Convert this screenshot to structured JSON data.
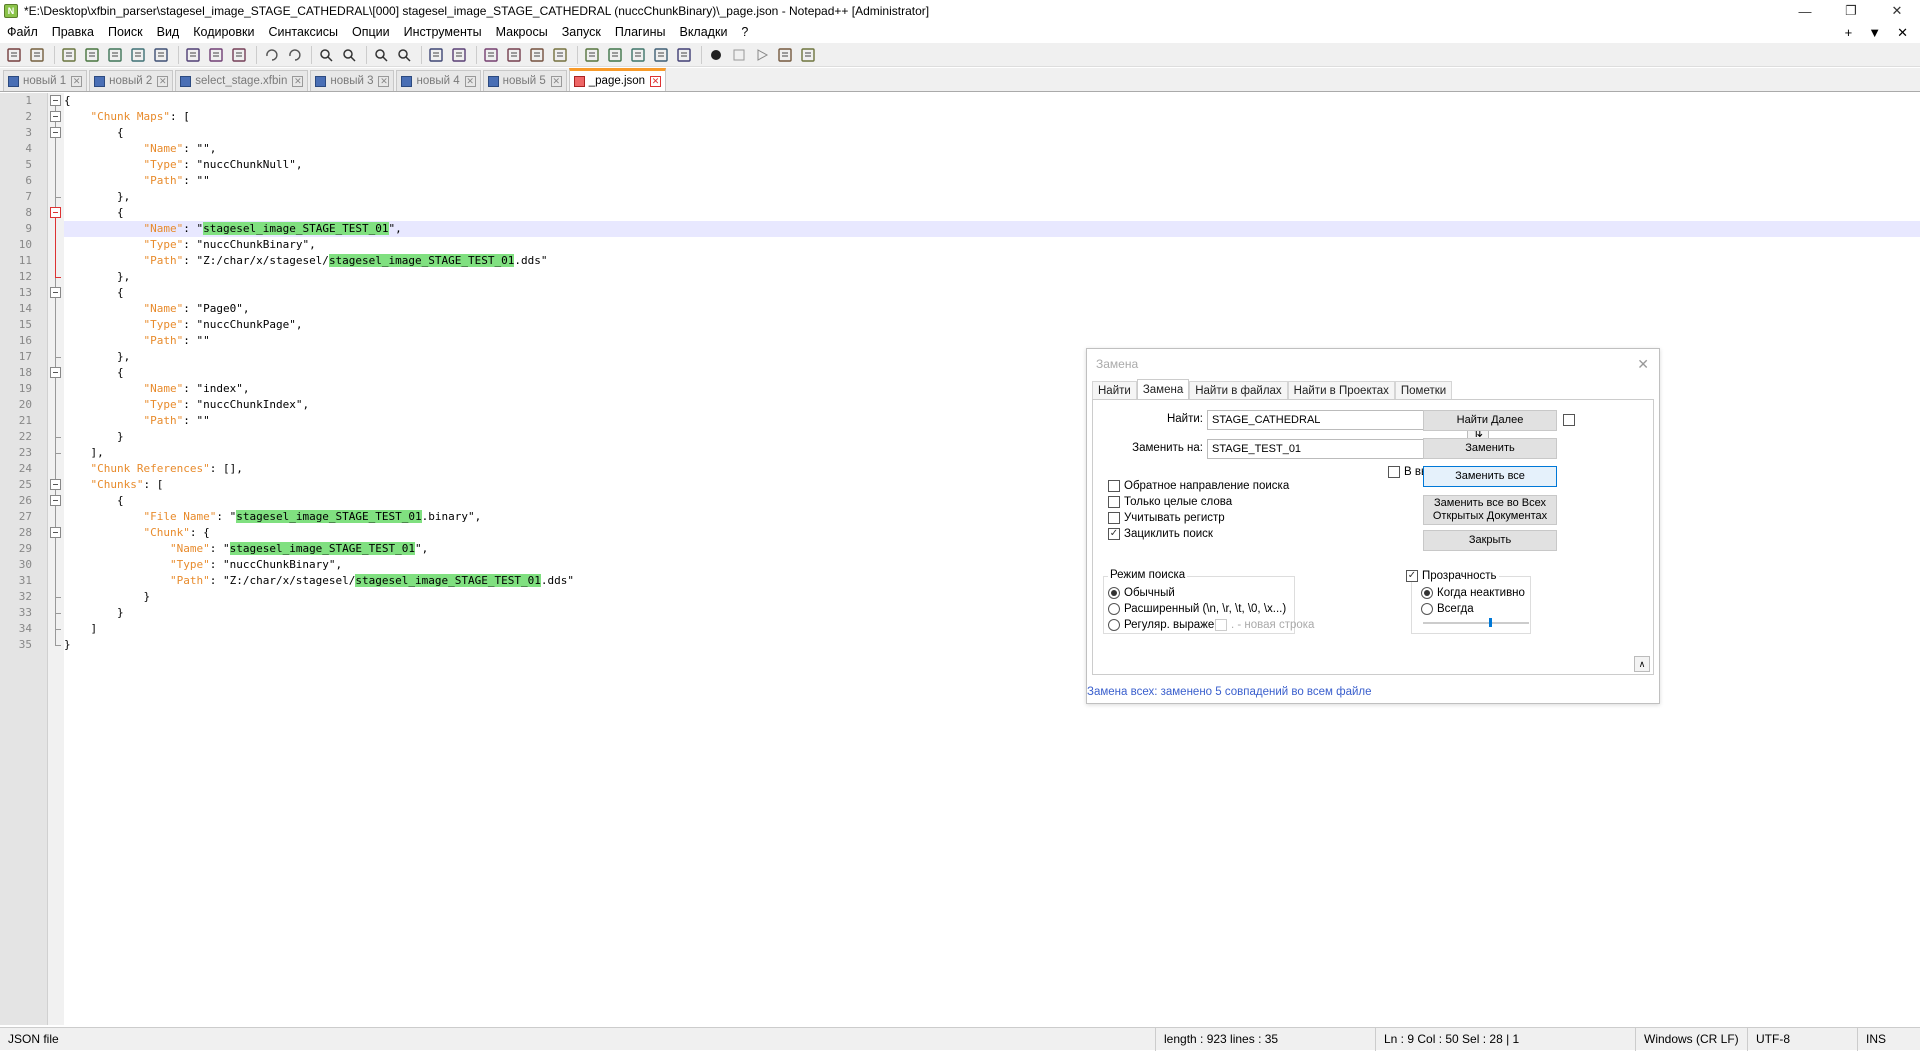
{
  "window": {
    "title": "*E:\\Desktop\\xfbin_parser\\stagesel_image_STAGE_CATHEDRAL\\[000] stagesel_image_STAGE_CATHEDRAL (nuccChunkBinary)\\_page.json - Notepad++ [Administrator]",
    "minimize": "—",
    "restore": "❐",
    "close": "✕"
  },
  "menu": {
    "items": [
      "Файл",
      "Правка",
      "Поиск",
      "Вид",
      "Кодировки",
      "Синтаксисы",
      "Опции",
      "Инструменты",
      "Макросы",
      "Запуск",
      "Плагины",
      "Вкладки",
      "?"
    ],
    "right": [
      "+",
      "▼",
      "✕"
    ]
  },
  "toolbar": {
    "icons": [
      "new-file-icon",
      "open-file-icon",
      "save-icon",
      "save-all-icon",
      "close-icon",
      "close-all-icon",
      "print-icon",
      "cut-icon",
      "copy-icon",
      "paste-icon",
      "undo-icon",
      "redo-icon",
      "find-icon",
      "replace-icon",
      "zoom-in-icon",
      "zoom-out-icon",
      "sync-vertical-icon",
      "sync-horizontal-icon",
      "word-wrap-icon",
      "show-all-chars-icon",
      "indent-guide-icon",
      "xml-tag-icon",
      "doc-map-icon",
      "doc-list-icon",
      "function-list-icon",
      "folder-workspace-icon",
      "monitor-icon",
      "record-macro-icon",
      "stop-record-icon",
      "play-macro-icon",
      "run-macro-multiple-icon",
      "save-macro-icon"
    ]
  },
  "tabs": [
    {
      "label": "новый 1",
      "active": false,
      "modified": false
    },
    {
      "label": "новый 2",
      "active": false,
      "modified": false
    },
    {
      "label": "select_stage.xfbin",
      "active": false,
      "modified": false
    },
    {
      "label": "новый 3",
      "active": false,
      "modified": false
    },
    {
      "label": "новый 4",
      "active": false,
      "modified": false
    },
    {
      "label": "новый 5",
      "active": false,
      "modified": false
    },
    {
      "label": "_page.json",
      "active": true,
      "modified": true
    }
  ],
  "editor": {
    "current_line": 9,
    "lines": [
      [
        [
          "p",
          "{"
        ]
      ],
      [
        [
          "p",
          "    "
        ],
        [
          "k",
          "\"Chunk Maps\""
        ],
        [
          "p",
          ": ["
        ]
      ],
      [
        [
          "p",
          "        {"
        ]
      ],
      [
        [
          "p",
          "            "
        ],
        [
          "k",
          "\"Name\""
        ],
        [
          "p",
          ": \"\","
        ]
      ],
      [
        [
          "p",
          "            "
        ],
        [
          "k",
          "\"Type\""
        ],
        [
          "p",
          ": \"nuccChunkNull\","
        ]
      ],
      [
        [
          "p",
          "            "
        ],
        [
          "k",
          "\"Path\""
        ],
        [
          "p",
          ": \"\""
        ]
      ],
      [
        [
          "p",
          "        },"
        ]
      ],
      [
        [
          "p",
          "        {"
        ]
      ],
      [
        [
          "p",
          "            "
        ],
        [
          "k",
          "\"Name\""
        ],
        [
          "p",
          ": \""
        ],
        [
          "hl",
          "stagesel_image_STAGE_TEST_01"
        ],
        [
          "p",
          "\","
        ]
      ],
      [
        [
          "p",
          "            "
        ],
        [
          "k",
          "\"Type\""
        ],
        [
          "p",
          ": \"nuccChunkBinary\","
        ]
      ],
      [
        [
          "p",
          "            "
        ],
        [
          "k",
          "\"Path\""
        ],
        [
          "p",
          ": \"Z:/char/x/stagesel/"
        ],
        [
          "hl",
          "stagesel_image_STAGE_TEST_01"
        ],
        [
          "p",
          ".dds\""
        ]
      ],
      [
        [
          "p",
          "        },"
        ]
      ],
      [
        [
          "p",
          "        {"
        ]
      ],
      [
        [
          "p",
          "            "
        ],
        [
          "k",
          "\"Name\""
        ],
        [
          "p",
          ": \"Page0\","
        ]
      ],
      [
        [
          "p",
          "            "
        ],
        [
          "k",
          "\"Type\""
        ],
        [
          "p",
          ": \"nuccChunkPage\","
        ]
      ],
      [
        [
          "p",
          "            "
        ],
        [
          "k",
          "\"Path\""
        ],
        [
          "p",
          ": \"\""
        ]
      ],
      [
        [
          "p",
          "        },"
        ]
      ],
      [
        [
          "p",
          "        {"
        ]
      ],
      [
        [
          "p",
          "            "
        ],
        [
          "k",
          "\"Name\""
        ],
        [
          "p",
          ": \"index\","
        ]
      ],
      [
        [
          "p",
          "            "
        ],
        [
          "k",
          "\"Type\""
        ],
        [
          "p",
          ": \"nuccChunkIndex\","
        ]
      ],
      [
        [
          "p",
          "            "
        ],
        [
          "k",
          "\"Path\""
        ],
        [
          "p",
          ": \"\""
        ]
      ],
      [
        [
          "p",
          "        }"
        ]
      ],
      [
        [
          "p",
          "    ],"
        ]
      ],
      [
        [
          "p",
          "    "
        ],
        [
          "k",
          "\"Chunk References\""
        ],
        [
          "p",
          ": [],"
        ]
      ],
      [
        [
          "p",
          "    "
        ],
        [
          "k",
          "\"Chunks\""
        ],
        [
          "p",
          ": ["
        ]
      ],
      [
        [
          "p",
          "        {"
        ]
      ],
      [
        [
          "p",
          "            "
        ],
        [
          "k",
          "\"File Name\""
        ],
        [
          "p",
          ": \""
        ],
        [
          "hl",
          "stagesel_image_STAGE_TEST_01"
        ],
        [
          "p",
          ".binary\","
        ]
      ],
      [
        [
          "p",
          "            "
        ],
        [
          "k",
          "\"Chunk\""
        ],
        [
          "p",
          ": {"
        ]
      ],
      [
        [
          "p",
          "                "
        ],
        [
          "k",
          "\"Name\""
        ],
        [
          "p",
          ": \""
        ],
        [
          "hl",
          "stagesel_image_STAGE_TEST_01"
        ],
        [
          "p",
          "\","
        ]
      ],
      [
        [
          "p",
          "                "
        ],
        [
          "k",
          "\"Type\""
        ],
        [
          "p",
          ": \"nuccChunkBinary\","
        ]
      ],
      [
        [
          "p",
          "                "
        ],
        [
          "k",
          "\"Path\""
        ],
        [
          "p",
          ": \"Z:/char/x/stagesel/"
        ],
        [
          "hl",
          "stagesel_image_STAGE_TEST_01"
        ],
        [
          "p",
          ".dds\""
        ]
      ],
      [
        [
          "p",
          "            }"
        ]
      ],
      [
        [
          "p",
          "        }"
        ]
      ],
      [
        [
          "p",
          "    ]"
        ]
      ],
      [
        [
          "p",
          "}"
        ]
      ]
    ]
  },
  "dialog": {
    "title": "Замена",
    "close": "✕",
    "tabs": [
      "Найти",
      "Замена",
      "Найти в файлах",
      "Найти в Проектах",
      "Пометки"
    ],
    "active_tab": 1,
    "find_label": "Найти:",
    "find_value": "STAGE_CATHEDRAL",
    "replace_label": "Заменить на:",
    "replace_value": "STAGE_TEST_01",
    "swap": "⇅",
    "in_selection": "В выделенном",
    "buttons": {
      "find_next": "Найти Далее",
      "replace": "Заменить",
      "replace_all": "Заменить все",
      "replace_all_open_1": "Заменить все во Всех",
      "replace_all_open_2": "Открытых Документах",
      "close": "Закрыть"
    },
    "options": [
      {
        "label": "Обратное направление поиска",
        "checked": false
      },
      {
        "label": "Только целые слова",
        "checked": false
      },
      {
        "label": "Учитывать регистр",
        "checked": false
      },
      {
        "label": "Зациклить поиск",
        "checked": true
      }
    ],
    "search_mode": {
      "title": "Режим поиска",
      "normal": "Обычный",
      "extended": "Расширенный (\\n, \\r, \\t, \\0, \\x...)",
      "regex": "Регуляр. выражен.",
      "newline": ". - новая строка",
      "selected": "normal"
    },
    "transparency": {
      "title": "Прозрачность",
      "checked": true,
      "on_inactive": "Когда неактивно",
      "always": "Всегда",
      "selected": "on_inactive",
      "level": 0.62
    },
    "up": "∧",
    "status": "Замена всех: заменено 5 совпадений во всем файле"
  },
  "status": {
    "filetype": "JSON file",
    "length": "length : 923    lines : 35",
    "position": "Ln : 9    Col : 50    Sel : 28 | 1",
    "eol": "Windows (CR LF)",
    "encoding": "UTF-8",
    "mode": "INS"
  },
  "colors": {
    "key": "#e88b2c",
    "highlight": "#80e080",
    "current_line": "#e8e8ff",
    "active_tab_accent": "#f89b2a",
    "dialog_status": "#3a5fcd"
  }
}
